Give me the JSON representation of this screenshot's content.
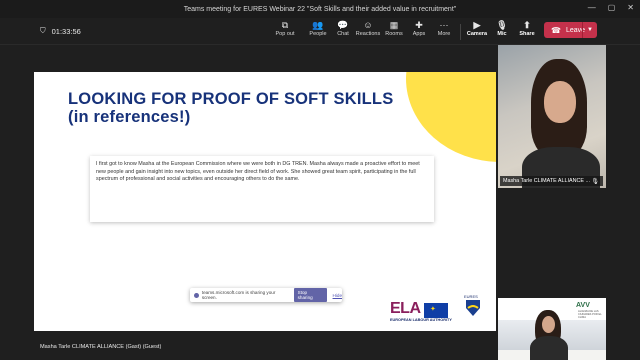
{
  "window": {
    "title": "Teams meeting for EURES Webinar 22 \"Soft Skills and their added value in recruitment\""
  },
  "window_controls": {
    "minimize": "—",
    "maximize": "▢",
    "close": "✕"
  },
  "call": {
    "timer": "01:33:56",
    "toolbar": [
      {
        "label": "Pop out",
        "icon": "pop-out-icon"
      },
      {
        "label": "People",
        "icon": "people-icon"
      },
      {
        "label": "Chat",
        "icon": "chat-icon"
      },
      {
        "label": "Reactions",
        "icon": "reactions-icon"
      },
      {
        "label": "Rooms",
        "icon": "rooms-icon"
      },
      {
        "label": "Apps",
        "icon": "apps-icon"
      },
      {
        "label": "More",
        "icon": "more-icon"
      },
      {
        "label": "Camera",
        "icon": "camera-icon"
      },
      {
        "label": "Mic",
        "icon": "mic-icon"
      },
      {
        "label": "Share",
        "icon": "share-icon"
      }
    ],
    "leave_label": "Leave",
    "leave_color": "#c4314b"
  },
  "slide": {
    "title_line1": "LOOKING FOR PROOF OF SOFT SKILLS",
    "title_line2": "(in references!)",
    "quote": "I first got to know Masha at the European Commission where we were both in DG TREN. Masha always made a proactive effort to meet new people and gain insight into new topics, even outside her direct field of work. She showed great team spirit, participating in the full spectrum of professional and social activities and encouraging others to do the same.",
    "title_color": "#17327a",
    "accent_color": "#ffe14a",
    "logo_ela": "ELA",
    "logo_ela_sub": "EUROPEAN LABOUR AUTHORITY",
    "logo_eures": "EURES"
  },
  "share_bar": {
    "text": "teams.microsoft.com is sharing your screen.",
    "stop_label": "Stop sharing",
    "hide_label": "Hide"
  },
  "participants": {
    "tile1_name": "Masha Tarle CLIMATE ALLIANCE ...",
    "tile2_logo": "AVV",
    "tile2_logo_sub": "ALIANZA DE LAS CIUDADES POR EL CLIMA",
    "bottom_name": "Masha Tarle CLIMATE ALLIANCE (Gast) (Guest)"
  }
}
